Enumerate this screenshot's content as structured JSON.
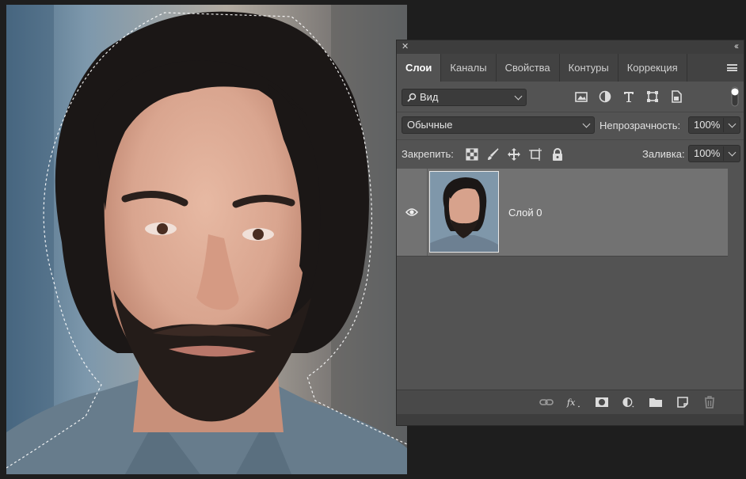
{
  "panel": {
    "tabs": [
      {
        "label": "Слои",
        "active": true
      },
      {
        "label": "Каналы"
      },
      {
        "label": "Свойства"
      },
      {
        "label": "Контуры"
      },
      {
        "label": "Коррекция"
      }
    ],
    "filter": {
      "label": "Вид"
    },
    "blend_mode": "Обычные",
    "opacity": {
      "label": "Непрозрачность:",
      "value": "100%"
    },
    "lock_label": "Закрепить:",
    "fill": {
      "label": "Заливка:",
      "value": "100%"
    },
    "layers": [
      {
        "name": "Слой 0",
        "visible": true,
        "selected": true
      }
    ]
  },
  "colors": {
    "panel_bg": "#535353",
    "tab_bar_bg": "#424242",
    "selected_layer_bg": "#727272",
    "app_bg": "#1e1e1e"
  },
  "icons": [
    "close-icon",
    "collapse-icon",
    "panel-menu-icon",
    "search-icon",
    "filter-pixel-icon",
    "filter-adjustment-icon",
    "filter-type-icon",
    "filter-shape-icon",
    "filter-smartobject-icon",
    "filter-toggle-icon",
    "lock-transparent-icon",
    "lock-brush-icon",
    "lock-move-icon",
    "lock-artboard-icon",
    "lock-all-icon",
    "eye-icon",
    "link-icon",
    "fx-icon",
    "mask-icon",
    "adjustment-layer-icon",
    "folder-icon",
    "new-layer-icon",
    "trash-icon"
  ]
}
